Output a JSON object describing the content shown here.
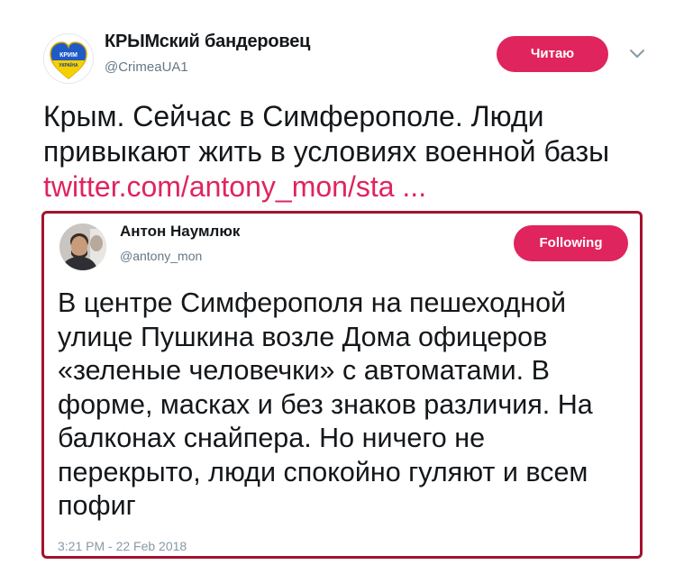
{
  "author": {
    "display_name": "КРЫМский бандеровец",
    "handle": "@CrimeaUA1",
    "avatar_icon": "crimea-heart-flag-avatar",
    "avatar_text_top": "КРИМ",
    "avatar_text_bottom": "УКРАЇНА",
    "follow_label": "Читаю"
  },
  "tweet": {
    "lines": [
      "Крым. Сейчас в Симферополе. Люди",
      "привыкают жить в условиях военной базы"
    ],
    "link": "twitter.com/antony_mon/sta ..."
  },
  "quoted": {
    "display_name": "Антон Наумлюк",
    "handle": "@antony_mon",
    "follow_label": "Following",
    "lines": [
      "В центре Симферополя на пешеходной",
      "улице Пушкина возле Дома офицеров",
      "«зеленые человечки» с автоматами. В",
      "форме, масках и без знаков различия. На",
      "балконах снайпера. Но ничего не",
      "перекрыто, люди спокойно гуляют и всем",
      "пофиг"
    ],
    "timestamp": "3:21 PM - 22 Feb 2018"
  },
  "colors": {
    "accent": "#e0245e",
    "quote_border": "#a3122e",
    "secondary_text": "#657786"
  }
}
